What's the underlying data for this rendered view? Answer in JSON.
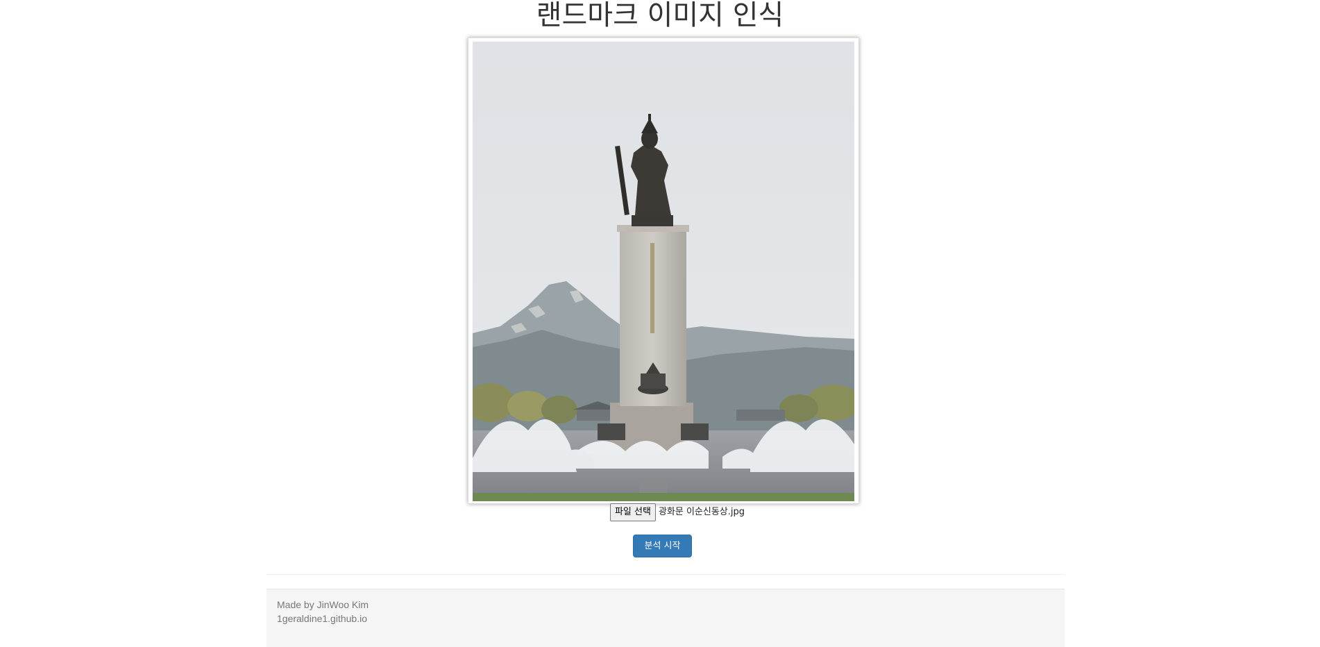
{
  "header": {
    "title": "랜드마크 이미지 인식"
  },
  "image_preview": {
    "subject": "statue-on-pedestal-with-fountains-and-mountain"
  },
  "upload": {
    "choose_file_label": "파일 선택",
    "file_name": "광화문 이순신동상.jpg"
  },
  "actions": {
    "analyze_label": "분석 시작"
  },
  "footer": {
    "author": "Made by JinWoo Kim",
    "site": "1geraldine1.github.io"
  },
  "colors": {
    "primary_button": "#337ab7",
    "footer_bg": "#f5f5f5",
    "title_text": "#333333"
  }
}
